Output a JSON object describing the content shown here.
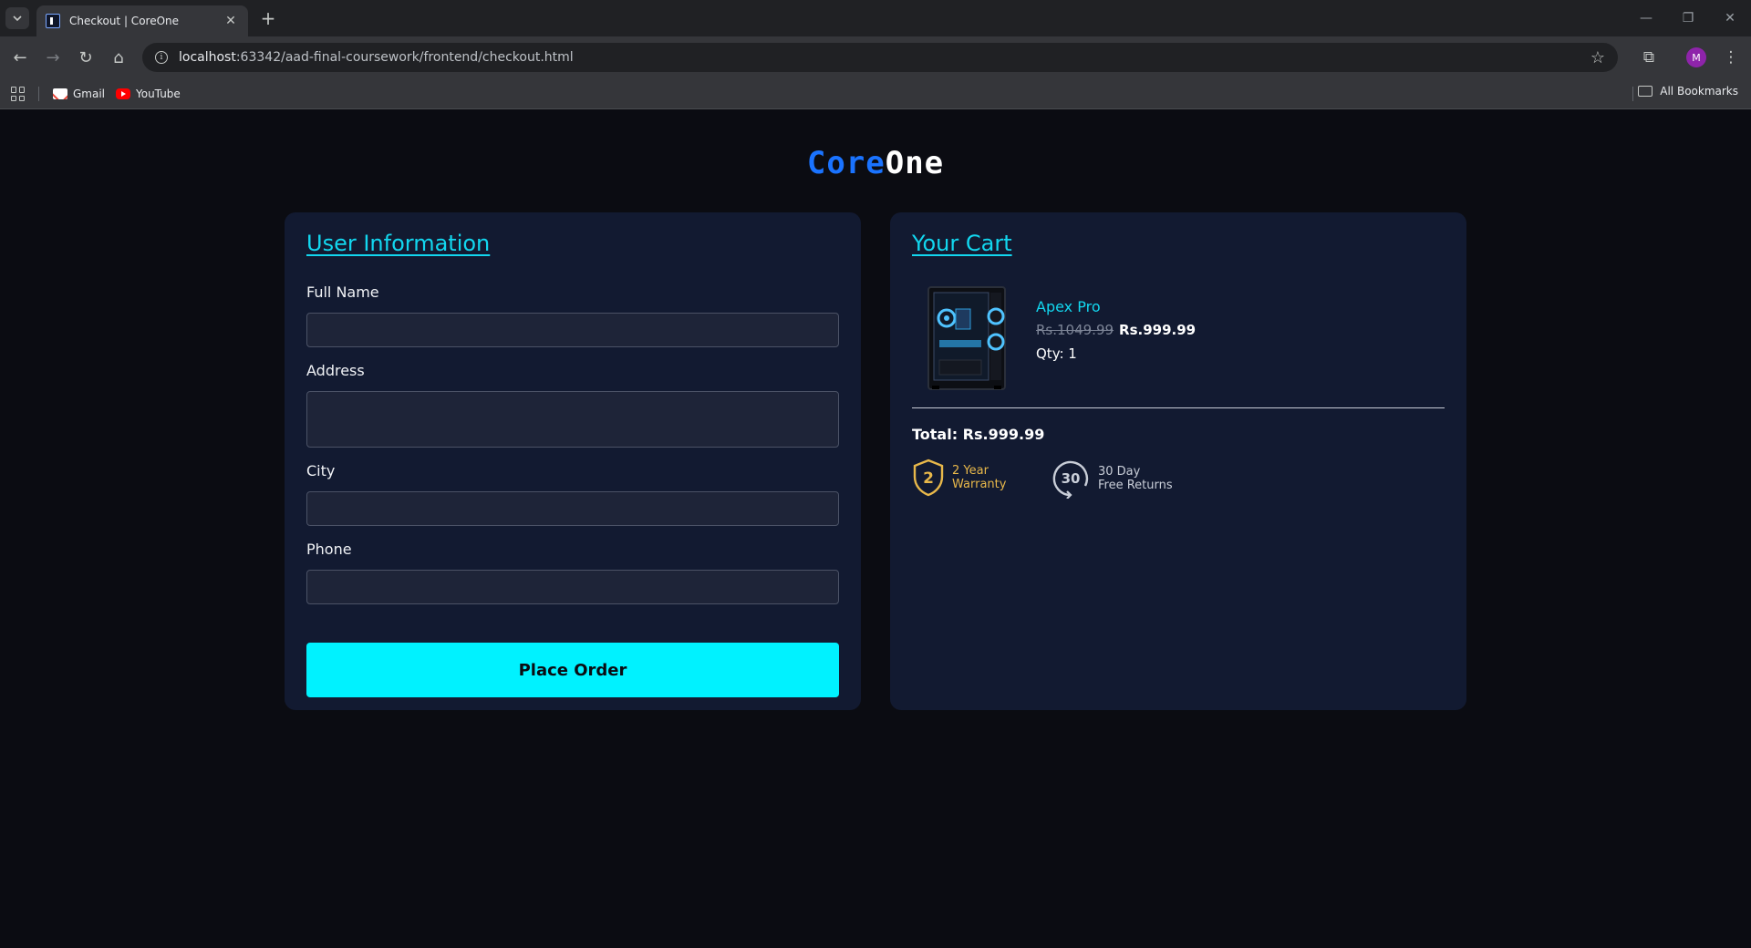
{
  "browser": {
    "tab_title": "Checkout | CoreOne",
    "url_host": "localhost",
    "url_path": ":63342/aad-final-coursework/frontend/checkout.html",
    "bookmarks": [
      "Gmail",
      "YouTube"
    ],
    "all_bookmarks": "All Bookmarks",
    "profile_initial": "M"
  },
  "logo": {
    "part1": "Core",
    "part2": "One",
    "colors": {
      "part1": "#1a73ff",
      "part2": "#ffffff"
    }
  },
  "user_info": {
    "heading": "User Information",
    "fields": [
      {
        "label": "Full Name",
        "value": ""
      },
      {
        "label": "Address",
        "value": ""
      },
      {
        "label": "City",
        "value": ""
      },
      {
        "label": "Phone",
        "value": ""
      }
    ],
    "submit_label": "Place Order"
  },
  "cart": {
    "heading": "Your Cart",
    "items": [
      {
        "name": "Apex Pro",
        "old_price": "Rs.1049.99",
        "price": "Rs.999.99",
        "qty_label": "Qty: 1"
      }
    ],
    "total_label": "Total: Rs.999.99",
    "badges": [
      {
        "icon": "shield-warranty-icon",
        "number": "2",
        "line1": "2 Year",
        "line2": "Warranty"
      },
      {
        "icon": "returns-30-icon",
        "number": "30",
        "line1": "30 Day",
        "line2": "Free Returns"
      }
    ]
  },
  "colors": {
    "accent": "#12d7ef",
    "button": "#00f2ff",
    "card_bg": "#121a31",
    "page_bg": "#0b0c12",
    "badge_gold": "#e8b84a"
  }
}
